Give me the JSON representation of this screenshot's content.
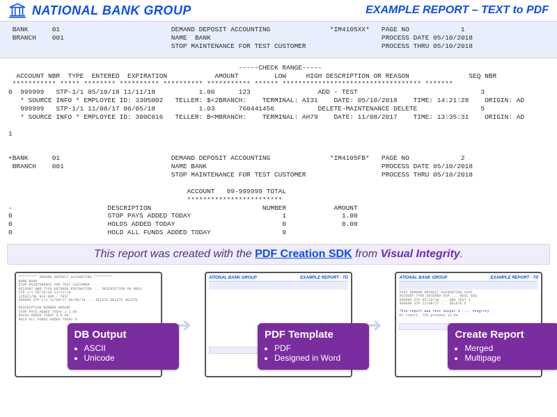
{
  "header": {
    "org_name": "NATIONAL BANK GROUP",
    "report_title": "EXAMPLE REPORT – TEXT to PDF"
  },
  "page1": {
    "bank_label": "BANK",
    "bank_code": "01",
    "branch_label": "BRANCH",
    "branch_code": "001",
    "center_1": "DEMAND DEPOSIT ACCOUNTING",
    "center_2": "NAME  BANK",
    "center_3": "STOP MAINTENANCE FOR TEST CUSTOMER",
    "report_id": "*IM4105XX*",
    "page_no_label": "PAGE NO",
    "page_no": "1",
    "process_date_label": "PROCESS DATE",
    "process_date": "05/10/2018",
    "process_thru_label": "PROCESS THRU",
    "process_thru": "05/10/2018"
  },
  "columns": {
    "range_hdr": "-----CHECK RANGE-----",
    "c1": "ACCOUNT NBR",
    "c2": "TYPE",
    "c3": "ENTERED",
    "c4": "EXPIRATION",
    "c5": "AMOUNT",
    "c6": "LOW",
    "c7": "HIGH",
    "c8": "DESCRIPTION OR REASON",
    "c9": "SEQ NBR"
  },
  "rows": [
    {
      "flag": "0",
      "acct": "999999",
      "type": "STP-1/1",
      "entered": "05/10/18",
      "exp": "11/11/18",
      "amount": "1.00",
      "low": "123",
      "high": "",
      "desc": "ADD - TEST",
      "seq": "3"
    },
    {
      "src": "* SOURCE INFO * EMPLOYEE ID: 3305002   TELLER: $<2",
      "branch": "BRANCH:",
      "terminal": "TERMINAL: AI31",
      "date": "DATE: 05/10/2018",
      "time": "TIME: 14:21:28",
      "origin": "ORIGIN: AD"
    },
    {
      "flag": "",
      "acct": "999999",
      "type": "STP-1/1",
      "entered": "11/08/17",
      "exp": "06/05/18",
      "amount": "1.03",
      "low": "760441456",
      "high": "",
      "desc": "DELETE-MAINTENANCE DELETE",
      "seq": "5"
    },
    {
      "src": "* SOURCE INFO * EMPLOYEE ID: 300C016   TELLER: B<M",
      "branch": "BRANCH:",
      "terminal": "TERMINAL: AH79",
      "date": "DATE: 11/08/2017",
      "time": "TIME: 13:35:31",
      "origin": "ORIGIN: AD"
    }
  ],
  "page2": {
    "bank_label": "+BANK",
    "bank_code": "01",
    "branch_label": "BRANCH",
    "branch_code": "001",
    "center_1": "DEMAND DEPOSIT ACCOUNTING",
    "center_2": "NAME BANK",
    "center_3": "STOP MAINTENANCE FOR TEST CUSTOMER",
    "report_id": "*IM4105FB*",
    "page_no_label": "PAGE NO",
    "page_no": "2",
    "process_date_label": "PROCESS DATE",
    "process_date": "05/10/2018",
    "process_thru_label": "PROCESS THRU",
    "process_thru": "05/10/2018"
  },
  "totals": {
    "acct_hdr": "ACCOUNT   99-999999 TOTAL",
    "rule": "************************",
    "cols": {
      "desc": "DESCRIPTION",
      "num": "NUMBER",
      "amt": "AMOUNT"
    },
    "rows": [
      {
        "flag": "-",
        "desc": "",
        "num": "",
        "amt": ""
      },
      {
        "flag": "0",
        "desc": "STOP PAYS ADDED TODAY",
        "num": "1",
        "amt": "1.00"
      },
      {
        "flag": "0",
        "desc": "HOLDS ADDED TODAY",
        "num": "0",
        "amt": "0.00"
      },
      {
        "flag": "0",
        "desc": "HOLD ALL FUNDS ADDED TODAY",
        "num": "0",
        "amt": ""
      }
    ]
  },
  "banner": {
    "prefix": "This report was created with the ",
    "link": "PDF Creation SDK",
    "mid": " from ",
    "brand": "Visual Integrity",
    "suffix": "."
  },
  "flow": {
    "step1": {
      "title": "DB Output",
      "bullets": [
        "ASCII",
        "Unicode"
      ]
    },
    "step2": {
      "title": "PDF Template",
      "bullets": [
        "PDF",
        "Designed in Word"
      ]
    },
    "step3": {
      "title": "Create Report",
      "bullets": [
        "Merged",
        "Multipage"
      ]
    }
  }
}
